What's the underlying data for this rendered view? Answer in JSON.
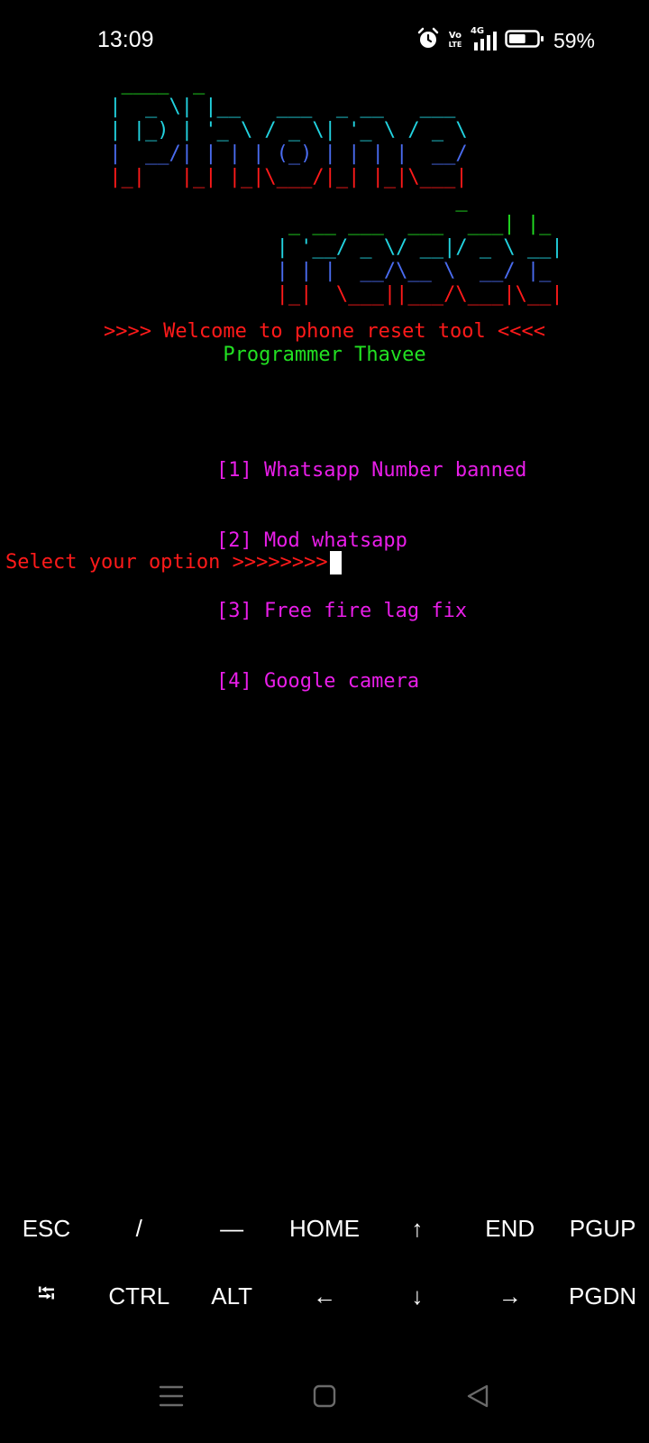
{
  "status_bar": {
    "time": "13:09",
    "volte_top": "Vo",
    "volte_bottom": "LTE",
    "network": "4G",
    "battery_percent": "59%",
    "battery_level": 0.59,
    "icons": [
      "alarm-icon",
      "volte-icon",
      "signal-icon",
      "battery-icon"
    ]
  },
  "terminal": {
    "banner_lines": [
      {
        "text": "  ____  _",
        "color": "#22e022"
      },
      {
        "text": " |  _ \\| |__   ___  _ __   ___",
        "color": "#22d3e0"
      },
      {
        "text": " | |_) | '_ \\ / _ \\| '_ \\ / _ \\",
        "color": "#22d3e0"
      },
      {
        "text": " |  __/| | | | (_) | | | |  __/",
        "color": "#4a6cf0"
      },
      {
        "text": " |_|   |_| |_|\\___/|_| |_|\\___|",
        "color": "#ff1a1a"
      },
      {
        "text": "                              _",
        "color": "#22e022"
      },
      {
        "text": "                _ __ ___  ___  ___| |_",
        "color": "#22e022"
      },
      {
        "text": "               | '__/ _ \\/ __|/ _ \\ __|",
        "color": "#22d3e0"
      },
      {
        "text": "               | | |  __/\\__ \\  __/ |_",
        "color": "#4a6cf0"
      },
      {
        "text": "               |_|  \\___||___/\\___|\\__|",
        "color": "#ff1a1a"
      }
    ],
    "welcome": ">>>> Welcome to phone reset tool <<<<",
    "programmer": "Programmer Thavee",
    "menu": [
      "[1] Whatsapp Number banned",
      "[2] Mod whatsapp",
      "[3] Free fire lag fix",
      "[4] Google camera"
    ],
    "prompt": "Select your option >>>>>>>>",
    "colors": {
      "welcome": "#ff1a1a",
      "programmer": "#22e022",
      "menu": "#e81ee8",
      "prompt": "#ff1a1a"
    }
  },
  "extra_keys": {
    "row1": [
      "ESC",
      "/",
      "—",
      "HOME",
      "↑",
      "END",
      "PGUP"
    ],
    "row2": [
      "⭾",
      "CTRL",
      "ALT",
      "←",
      "↓",
      "→",
      "PGDN"
    ]
  },
  "nav_bar": {
    "icons": [
      "recent-apps-icon",
      "home-icon",
      "back-icon"
    ]
  }
}
